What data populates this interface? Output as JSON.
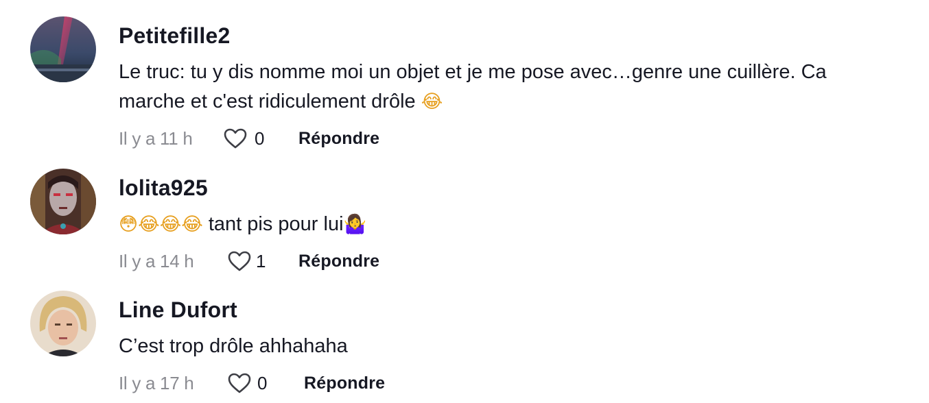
{
  "comments": [
    {
      "username": "Petitefille2",
      "text_line1": "Le truc: tu y dis nomme moi un objet et je me pose avec…genre une cuillère. Ca",
      "text_line2": "marche et c'est ridiculement drôle",
      "emojis": "😂",
      "time": "Il y a 11 h",
      "likes": "0",
      "reply_label": "Répondre",
      "avatar_icon": "aurora-landscape-avatar"
    },
    {
      "username": "lolita925",
      "emojis_before": "😳😂😂😂",
      "text": " tant pis pour lui",
      "emojis_after": "🤷‍♀️",
      "time": "Il y a 14 h",
      "likes": "1",
      "reply_label": "Répondre",
      "avatar_icon": "portrait-avatar"
    },
    {
      "username": "Line Dufort",
      "text": "C’est trop drôle ahhahaha",
      "time": "Il y a 17 h",
      "likes": "0",
      "reply_label": "Répondre",
      "avatar_icon": "selfie-avatar"
    }
  ],
  "icons": {
    "like": "heart-outline-icon"
  },
  "colors": {
    "text": "#161823",
    "meta": "#8a8b91",
    "heart_stroke": "#3d3e45"
  }
}
